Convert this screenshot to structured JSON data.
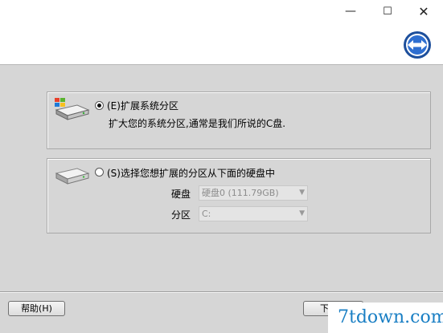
{
  "window": {
    "minimize_glyph": "—",
    "maximize_glyph": "☐",
    "close_glyph": "✕",
    "logo_icon": "double-arrow-icon"
  },
  "options": [
    {
      "label": "(E)扩展系统分区",
      "description": "扩大您的系统分区,通常是我们所说的C盘.",
      "selected": true,
      "icon": "windows-disk-icon"
    },
    {
      "label": "(S)选择您想扩展的分区从下面的硬盘中",
      "selected": false,
      "icon": "disk-icon",
      "fields": [
        {
          "label": "硬盘",
          "value": "硬盘0 (111.79GB)",
          "enabled": false
        },
        {
          "label": "分区",
          "value": "C:",
          "enabled": false
        }
      ]
    }
  ],
  "buttons": {
    "help": "帮助(H)",
    "next": "下一步"
  },
  "watermark": "7tdown.com",
  "colors": {
    "accent": "#1a5fb4",
    "watermark": "#1a7fc4",
    "background": "#d6d6d6"
  }
}
